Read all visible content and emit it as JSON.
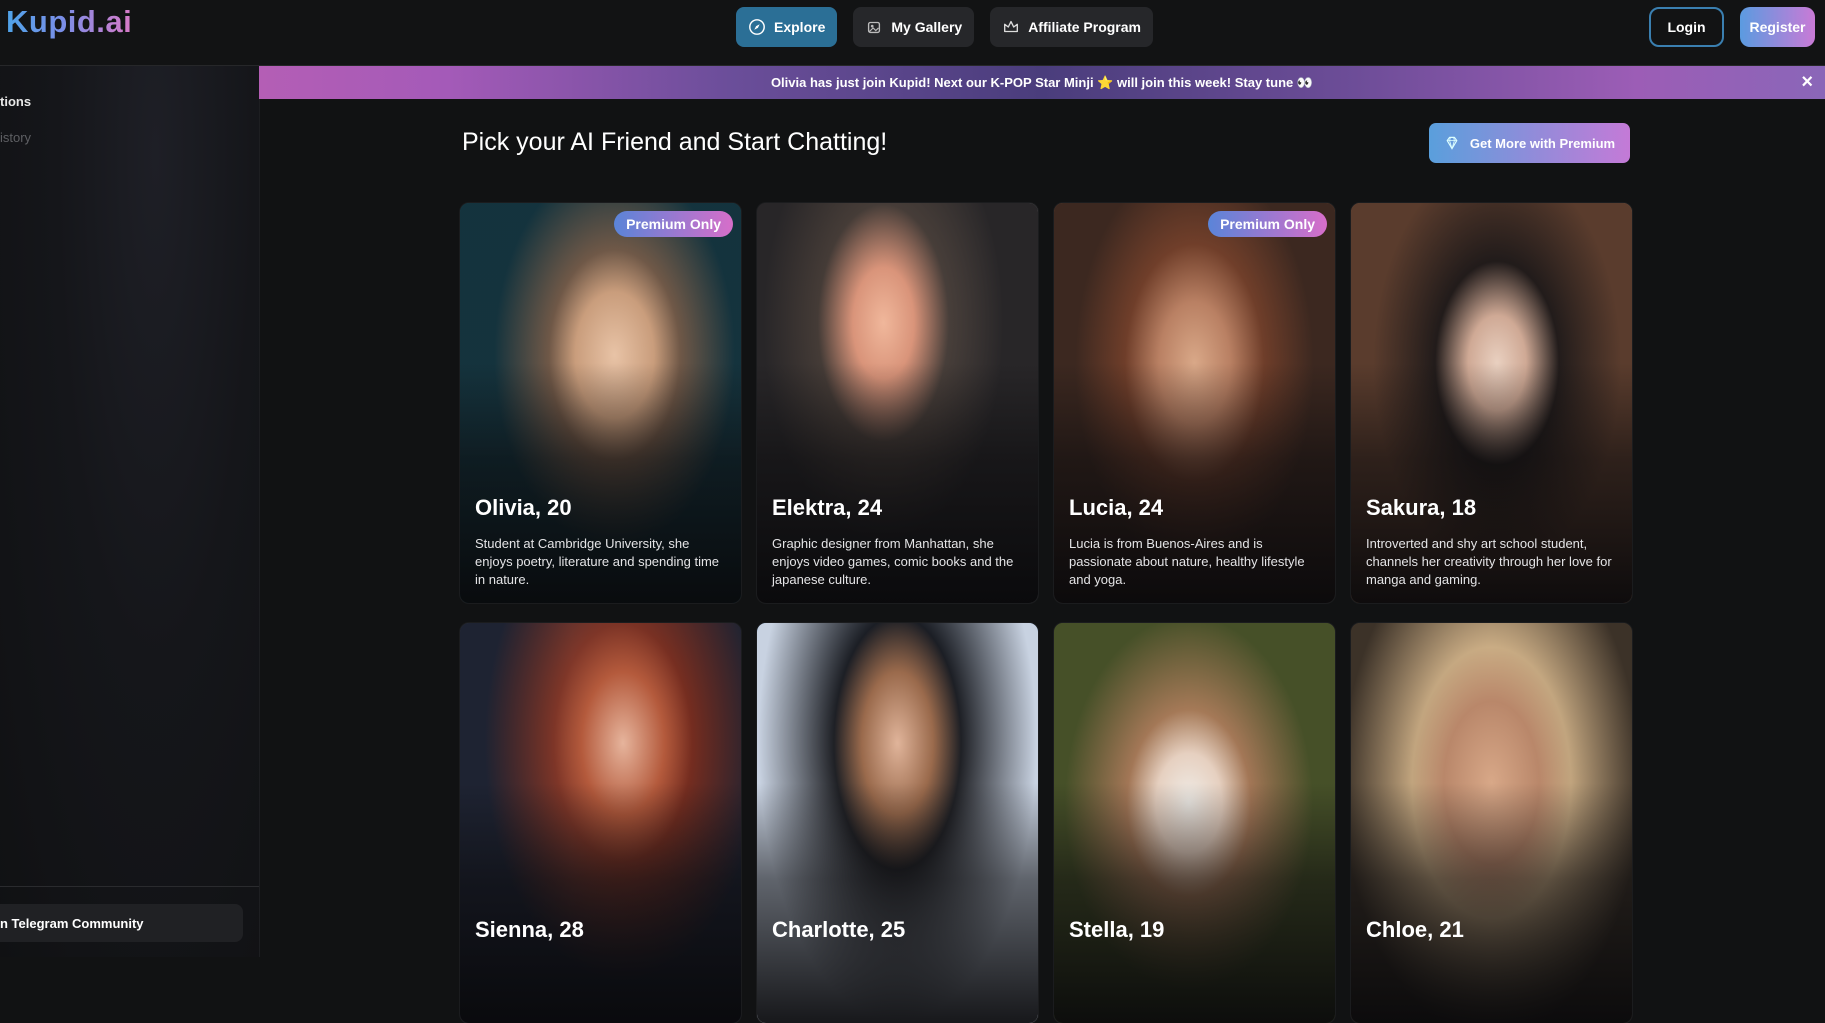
{
  "header": {
    "logo": "Kupid.ai",
    "nav": [
      {
        "label": "Explore",
        "icon": "compass-icon",
        "active": true
      },
      {
        "label": "My Gallery",
        "icon": "gallery-icon",
        "active": false
      },
      {
        "label": "Affiliate Program",
        "icon": "crown-icon",
        "active": false
      }
    ],
    "login_label": "Login",
    "register_label": "Register"
  },
  "sidebar": {
    "item_top": "tions",
    "item_second": "istory",
    "telegram_label": "n Telegram Community"
  },
  "announcement": {
    "text": "Olivia has just join Kupid! Next our K-POP Star Minji ⭐ will join this week! Stay tune 👀",
    "close_icon": "close-icon"
  },
  "main": {
    "heading": "Pick your AI Friend and Start Chatting!",
    "premium_button": "Get More with Premium",
    "premium_icon": "diamond-icon"
  },
  "colors": {
    "accent_blue": "#2b6f96",
    "gradient_start": "#5a9fdc",
    "gradient_end": "#c47ad7"
  },
  "characters": [
    {
      "name": "Olivia, 20",
      "badge": "Premium Only",
      "description": "Student at Cambridge University, she enjoys poetry, literature and spending time in nature."
    },
    {
      "name": "Elektra, 24",
      "badge": "",
      "description": "Graphic designer from Manhattan, she enjoys video games, comic books and the japanese culture."
    },
    {
      "name": "Lucia, 24",
      "badge": "Premium Only",
      "description": "Lucia is from Buenos-Aires and is passionate about nature, healthy lifestyle and yoga."
    },
    {
      "name": "Sakura, 18",
      "badge": "",
      "description": "Introverted and shy art school student, channels her creativity through her love for manga and gaming."
    },
    {
      "name": "Sienna, 28",
      "badge": "",
      "description": ""
    },
    {
      "name": "Charlotte, 25",
      "badge": "",
      "description": ""
    },
    {
      "name": "Stella, 19",
      "badge": "",
      "description": ""
    },
    {
      "name": "Chloe, 21",
      "badge": "",
      "description": ""
    }
  ]
}
